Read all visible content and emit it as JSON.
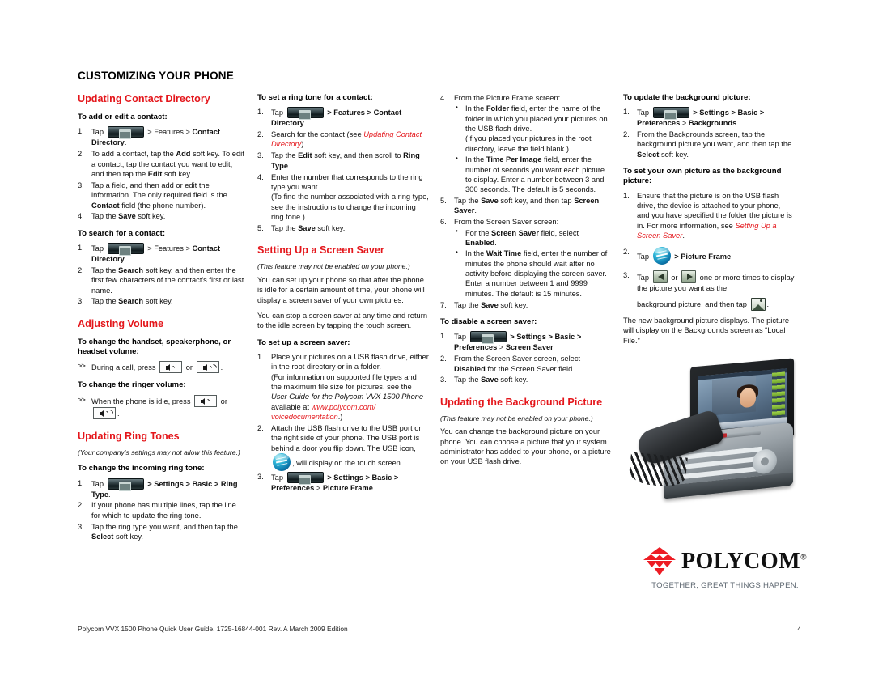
{
  "document": {
    "title": "CUSTOMIZING YOUR PHONE",
    "footer_left": "Polycom VVX 1500 Phone Quick User Guide. 1725-16844-001 Rev. A  March 2009 Edition",
    "footer_page": "4"
  },
  "brand": {
    "name": "POLYCOM",
    "trademark": "®",
    "tagline": "TOGETHER, GREAT THINGS HAPPEN.",
    "mark_color": "#ED1C24",
    "accent_color": "#E4161B"
  },
  "icons": {
    "home": "home-key-icon",
    "volume_down": "volume-down-icon",
    "volume_up": "volume-up-icon",
    "usb": "usb-icon",
    "arrow_left": "arrow-left-icon",
    "arrow_right": "arrow-right-icon",
    "picture": "picture-frame-icon",
    "phone_photo": "polycom-vvx-1500-phone-photo"
  },
  "column1": {
    "section1_heading": "Updating Contact Directory",
    "sub1": "To add or edit a contact:",
    "sub1_steps": {
      "s1_a": "Tap",
      "s1_b": "> Features >",
      "s1_c": "Contact Directory",
      "s1_d": ".",
      "s2_a": "To add a contact, tap the ",
      "s2_b": "Add",
      "s2_c": " soft key. To edit a contact, tap the contact you want to edit, and then tap the ",
      "s2_d": "Edit",
      "s2_e": " soft key.",
      "s3_a": "Tap a field, and then add or edit the information. The only required field is the ",
      "s3_b": "Contact",
      "s3_c": " field (the phone number).",
      "s4_a": "Tap the ",
      "s4_b": "Save",
      "s4_c": " soft key."
    },
    "sub2": "To search for a contact:",
    "sub2_steps": {
      "s1_a": "Tap",
      "s1_b": "> Features >",
      "s1_c": "Contact Directory",
      "s1_d": ".",
      "s2_a": "Tap the ",
      "s2_b": "Search",
      "s2_c": " soft key, and then enter the first few characters of the contact's first or last name.",
      "s3_a": "Tap the ",
      "s3_b": "Search",
      "s3_c": " soft key."
    },
    "section2_heading": "Adjusting Volume",
    "sub3": "To change the handset, speakerphone, or headset volume:",
    "vol_line_a": "During a call, press",
    "vol_line_or": "or",
    "vol_line_end": ".",
    "sub4": "To change the ringer volume:",
    "ringer_line_a": "When the phone is idle, press",
    "ringer_line_or": "or",
    "ringer_line_end": ".",
    "section3_heading": "Updating Ring Tones",
    "section3_note": "(Your company's settings may not allow this feature.)",
    "sub5": "To change the incoming ring tone:",
    "sub5_steps": {
      "s1_a": "Tap",
      "s1_b": "> Settings > Basic >",
      "s1_c": "Ring Type",
      "s1_d": ".",
      "s2": "If your phone has multiple lines, tap the line for which to update the ring tone.",
      "s3_a": "Tap the ring type you want, and then tap the ",
      "s3_b": "Select",
      "s3_c": " soft key."
    }
  },
  "column2": {
    "sub1": "To set a ring tone for a contact:",
    "steps": {
      "s1_a": "Tap",
      "s1_b": "> Features >",
      "s1_c": "Contact Directory",
      "s1_d": ".",
      "s2_a": "Search for the contact (see ",
      "s2_link": "Updating Contact Directory",
      "s2_b": ").",
      "s3_a": "Tap the ",
      "s3_b": "Edit",
      "s3_c": " soft key, and then scroll to ",
      "s3_d": "Ring Type",
      "s3_e": ".",
      "s4_a": "Enter the number that corresponds to the ring type you want.",
      "s4_b": "(To find the number associated with a ring type, see the instructions to change the incoming ring tone.)",
      "s5_a": "Tap the ",
      "s5_b": "Save",
      "s5_c": " soft key."
    },
    "section_heading": "Setting Up a Screen Saver",
    "section_note": "(This feature may not be enabled on your phone.)",
    "para1": "You can set up your phone so that after the phone is idle for a certain amount of time, your phone will display a screen saver of your own pictures.",
    "para2": "You can stop a screen saver at any time and return to the idle screen by tapping the touch screen.",
    "sub2": "To set up a screen saver:",
    "setup_steps": {
      "s1_a": "Place your pictures on a USB flash drive, either in the root directory or in a folder.",
      "s1_b1": "(For information on supported file types and the maximum file size for pictures, see the ",
      "s1_b2": "User Guide for the Polycom VVX 1500 Phone",
      "s1_b3": " available at ",
      "s1_link": "www.polycom.com/ voicedocumentation",
      "s1_b4": ".)",
      "s2_a": "Attach the USB flash drive to the USB port on the right side of your phone. The USB port is behind a door you flip down. The USB icon,",
      "s2_b": ", will display on the touch screen.",
      "s3_a": "Tap",
      "s3_b": "> Settings > Basic >",
      "s3_c": "Preferences",
      "s3_d": " > ",
      "s3_e": "Picture Frame",
      "s3_f": "."
    }
  },
  "column3": {
    "step4_lead": "From the Picture Frame screen:",
    "step4_bullets": {
      "b1_a": "In the ",
      "b1_b": "Folder",
      "b1_c": " field, enter the name of the folder in which you placed your pictures on the USB flash drive.",
      "b1_d": "(If you placed your pictures in the root directory, leave the field blank.)",
      "b2_a": "In the ",
      "b2_b": "Time Per Image",
      "b2_c": " field, enter the number of seconds you want each picture to display. Enter a number between 3 and 300 seconds. The default is 5 seconds."
    },
    "step5_a": "Tap the ",
    "step5_b": "Save",
    "step5_c": " soft key, and then tap ",
    "step5_d": "Screen Saver",
    "step5_e": ".",
    "step6_lead": "From the Screen Saver screen:",
    "step6_bullets": {
      "b1_a": "For the ",
      "b1_b": "Screen Saver",
      "b1_c": " field, select ",
      "b1_d": "Enabled",
      "b1_e": ".",
      "b2_a": "In the ",
      "b2_b": "Wait Time",
      "b2_c": " field, enter the number of minutes the phone should wait after no activity before displaying the screen saver. Enter a number between 1 and 9999 minutes. The default is 15 minutes."
    },
    "step7_a": "Tap the ",
    "step7_b": "Save",
    "step7_c": " soft key.",
    "sub_disable": "To disable a screen saver:",
    "disable_steps": {
      "s1_a": "Tap",
      "s1_b": "> Settings > Basic >",
      "s1_c": "Preferences",
      "s1_d": " > ",
      "s1_e": "Screen Saver",
      "s2_a": "From the Screen Saver screen, select ",
      "s2_b": "Disabled",
      "s2_c": " for the Screen Saver field.",
      "s3_a": "Tap the ",
      "s3_b": "Save",
      "s3_c": " soft key."
    },
    "section_heading": "Updating the Background Picture",
    "section_note": "(This feature may not be enabled on your phone.)",
    "para1": "You can change the background picture on your phone. You can choose a picture that your system administrator has added to your phone, or a picture on your USB flash drive."
  },
  "column4": {
    "sub1": "To update the background picture:",
    "update_steps": {
      "s1_a": "Tap",
      "s1_b": "> Settings > Basic >",
      "s1_c": "Preferences",
      "s1_d": " > ",
      "s1_e": "Backgrounds",
      "s1_f": ".",
      "s2_a": "From the Backgrounds screen, tap the background picture you want, and then tap the ",
      "s2_b": "Select",
      "s2_c": " soft key."
    },
    "sub2": "To set your own picture as the background picture:",
    "own_steps": {
      "s1_a": "Ensure that the picture is on the USB flash drive, the device is attached to your phone, and you have specified the folder the picture is in. For more information, see ",
      "s1_link": "Setting Up a Screen Saver",
      "s1_b": ".",
      "s2_a": "Tap",
      "s2_b": "> ",
      "s2_c": "Picture Frame",
      "s2_d": ".",
      "s3_a": "Tap",
      "s3_or": "or",
      "s3_b": "one or more times to display the picture you want as the",
      "s3_c": "background picture, and then tap",
      "s3_d": "."
    },
    "closing": "The new background picture displays. The picture will display on the Backgrounds screen as “Local File.”"
  }
}
